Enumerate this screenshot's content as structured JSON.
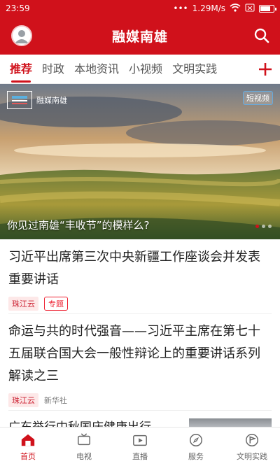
{
  "status": {
    "time": "23:59",
    "speed": "1.29M/s",
    "battery_level": 0.8
  },
  "header": {
    "title": "融媒南雄"
  },
  "tabs": [
    {
      "label": "推荐",
      "active": true
    },
    {
      "label": "时政"
    },
    {
      "label": "本地资讯"
    },
    {
      "label": "小视频"
    },
    {
      "label": "文明实践"
    }
  ],
  "hero": {
    "badge": "短视频",
    "logo_text": "融媒南雄",
    "caption": "你见过南雄“丰收节”的模样么?"
  },
  "news": [
    {
      "title": "习近平出席第三次中央新疆工作座谈会并发表重要讲话",
      "source": "珠江云",
      "tag": "专题"
    },
    {
      "title": "命运与共的时代强音——习近平主席在第七十五届联合国大会一般性辩论上的重要讲话系列解读之三",
      "source": "珠江云",
      "publisher": "新华社"
    },
    {
      "title": "广东举行中秋国庆健康出行"
    }
  ],
  "bottom_nav": [
    {
      "label": "首页",
      "icon": "home-icon",
      "active": true
    },
    {
      "label": "电视",
      "icon": "tv-icon"
    },
    {
      "label": "直播",
      "icon": "live-icon"
    },
    {
      "label": "服务",
      "icon": "compass-icon"
    },
    {
      "label": "文明实践",
      "icon": "flag-icon"
    }
  ],
  "colors": {
    "brand": "#d0111b"
  }
}
